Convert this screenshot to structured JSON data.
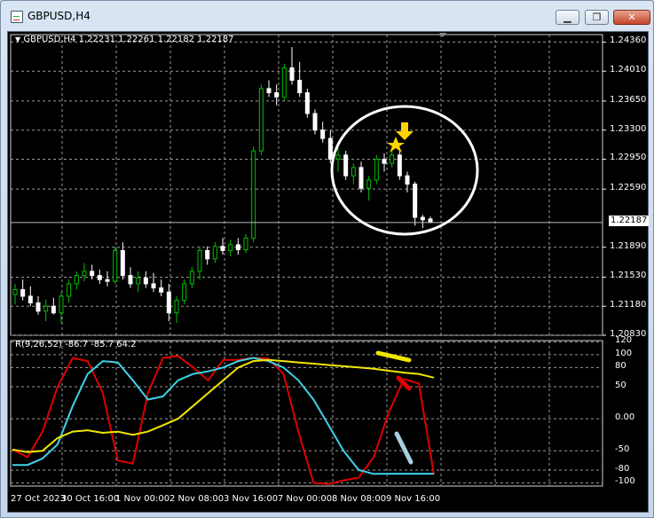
{
  "window": {
    "title": "GBPUSD,H4",
    "min_label": "▁",
    "max_label": "❐",
    "close_label": "✕"
  },
  "icons": {
    "app": "chart-app-icon",
    "dropdown": "triangle-down-icon",
    "star": "star-icon",
    "arrow": "arrow-down-icon"
  },
  "colors": {
    "bull": "#00c000",
    "bear": "#ffffff",
    "grid": "#9a9a9a",
    "osc_red": "#e00000",
    "osc_cyan": "#3fd2e8",
    "osc_yellow": "#f2e600",
    "circle": "#ffffff",
    "marker": "#ffd400"
  },
  "main_chart": {
    "header": "GBPUSD,H4  1.22231 1.22261 1.22182 1.22187",
    "current_price": "1.22187",
    "y_labels": [
      "1.24360",
      "1.24010",
      "1.23650",
      "1.23300",
      "1.22950",
      "1.22590",
      "1.21890",
      "1.21530",
      "1.21180",
      "1.20830"
    ]
  },
  "sub_chart": {
    "header": "R(9,26,52) -86.7 -85.7 64.2",
    "y_labels": [
      "120",
      "100",
      "80",
      "50",
      "0.00",
      "-50",
      "-80",
      "-100"
    ]
  },
  "x_labels": [
    "27 Oct 2023",
    "30 Oct 16:00",
    "1 Nov 00:00",
    "2 Nov 08:00",
    "3 Nov 16:00",
    "7 Nov 00:00",
    "8 Nov 08:00",
    "9 Nov 16:00"
  ],
  "chart_data": {
    "type": "line",
    "series_type": "candlestick",
    "symbol": "GBPUSD",
    "timeframe": "H4",
    "last_ohlc": {
      "open": 1.22231,
      "high": 1.22261,
      "low": 1.22182,
      "close": 1.22187
    },
    "ylim": [
      1.2083,
      1.2445
    ],
    "candles": [
      [
        1.2132,
        1.2145,
        1.212,
        1.2138
      ],
      [
        1.2138,
        1.215,
        1.2125,
        1.213
      ],
      [
        1.213,
        1.2142,
        1.2118,
        1.2122
      ],
      [
        1.2122,
        1.213,
        1.2108,
        1.2112
      ],
      [
        1.2112,
        1.2126,
        1.21,
        1.2118
      ],
      [
        1.2118,
        1.2128,
        1.2108,
        1.211
      ],
      [
        1.211,
        1.2135,
        1.2098,
        1.213
      ],
      [
        1.213,
        1.215,
        1.2122,
        1.2145
      ],
      [
        1.2145,
        1.216,
        1.2138,
        1.2155
      ],
      [
        1.2155,
        1.217,
        1.2148,
        1.216
      ],
      [
        1.216,
        1.2168,
        1.215,
        1.2155
      ],
      [
        1.2155,
        1.2162,
        1.2145,
        1.215
      ],
      [
        1.215,
        1.216,
        1.2142,
        1.2148
      ],
      [
        1.2148,
        1.219,
        1.2145,
        1.2185
      ],
      [
        1.2185,
        1.2195,
        1.215,
        1.2155
      ],
      [
        1.2155,
        1.2165,
        1.214,
        1.2145
      ],
      [
        1.2145,
        1.216,
        1.2135,
        1.2152
      ],
      [
        1.2152,
        1.216,
        1.214,
        1.2145
      ],
      [
        1.2145,
        1.2158,
        1.2135,
        1.214
      ],
      [
        1.214,
        1.215,
        1.213,
        1.2135
      ],
      [
        1.2135,
        1.2145,
        1.21,
        1.211
      ],
      [
        1.211,
        1.213,
        1.2098,
        1.2125
      ],
      [
        1.2125,
        1.215,
        1.212,
        1.2145
      ],
      [
        1.2145,
        1.2165,
        1.214,
        1.216
      ],
      [
        1.216,
        1.219,
        1.215,
        1.2185
      ],
      [
        1.2185,
        1.219,
        1.2168,
        1.2175
      ],
      [
        1.2175,
        1.2195,
        1.217,
        1.219
      ],
      [
        1.219,
        1.22,
        1.218,
        1.2185
      ],
      [
        1.2185,
        1.2198,
        1.2178,
        1.2192
      ],
      [
        1.2192,
        1.22,
        1.218,
        1.2186
      ],
      [
        1.2186,
        1.2205,
        1.2182,
        1.22
      ],
      [
        1.22,
        1.231,
        1.2195,
        1.2305
      ],
      [
        1.2305,
        1.2385,
        1.23,
        1.238
      ],
      [
        1.238,
        1.239,
        1.237,
        1.2375
      ],
      [
        1.2375,
        1.2385,
        1.236,
        1.237
      ],
      [
        1.237,
        1.241,
        1.2365,
        1.2405
      ],
      [
        1.2405,
        1.243,
        1.2385,
        1.239
      ],
      [
        1.239,
        1.2412,
        1.237,
        1.2375
      ],
      [
        1.2375,
        1.238,
        1.2345,
        1.235
      ],
      [
        1.235,
        1.2355,
        1.2325,
        1.233
      ],
      [
        1.233,
        1.234,
        1.2315,
        1.232
      ],
      [
        1.232,
        1.233,
        1.229,
        1.2295
      ],
      [
        1.2295,
        1.231,
        1.228,
        1.23
      ],
      [
        1.23,
        1.2305,
        1.227,
        1.2275
      ],
      [
        1.2275,
        1.229,
        1.2265,
        1.2285
      ],
      [
        1.2285,
        1.2292,
        1.2255,
        1.226
      ],
      [
        1.226,
        1.2275,
        1.2245,
        1.227
      ],
      [
        1.227,
        1.23,
        1.2265,
        1.2295
      ],
      [
        1.2295,
        1.2302,
        1.228,
        1.229
      ],
      [
        1.229,
        1.2305,
        1.2285,
        1.23
      ],
      [
        1.23,
        1.2305,
        1.227,
        1.2275
      ],
      [
        1.2275,
        1.228,
        1.2255,
        1.2265
      ],
      [
        1.2265,
        1.2268,
        1.2215,
        1.2225
      ],
      [
        1.2225,
        1.2228,
        1.2212,
        1.2222
      ],
      [
        1.2223,
        1.2226,
        1.2218,
        1.2219
      ]
    ],
    "oscillator": {
      "name": "R(9,26,52)",
      "values_label": "-86.7 -85.7 64.2",
      "ylim": [
        -105,
        122
      ],
      "series": [
        {
          "name": "9",
          "color": "#e00000",
          "values": [
            -48,
            -60,
            -20,
            50,
            95,
            90,
            40,
            -65,
            -70,
            40,
            95,
            98,
            80,
            60,
            92,
            92,
            95,
            94,
            70,
            -20,
            -100,
            -102,
            -96,
            -92,
            -60,
            10,
            62,
            55,
            -86.7
          ]
        },
        {
          "name": "26",
          "color": "#3fd2e8",
          "values": [
            -72,
            -72,
            -62,
            -40,
            20,
            70,
            90,
            88,
            60,
            30,
            35,
            60,
            70,
            74,
            80,
            90,
            95,
            90,
            80,
            60,
            30,
            -10,
            -50,
            -80,
            -86,
            -85.7,
            -85.7,
            -85.7,
            -85.7
          ]
        },
        {
          "name": "52",
          "color": "#f2e600",
          "values": [
            -48,
            -52,
            -50,
            -30,
            -20,
            -18,
            -22,
            -20,
            -25,
            -20,
            -10,
            0,
            20,
            40,
            60,
            80,
            90,
            92,
            90,
            88,
            86,
            84,
            82,
            80,
            78,
            75,
            72,
            70,
            64.2
          ]
        }
      ]
    }
  }
}
